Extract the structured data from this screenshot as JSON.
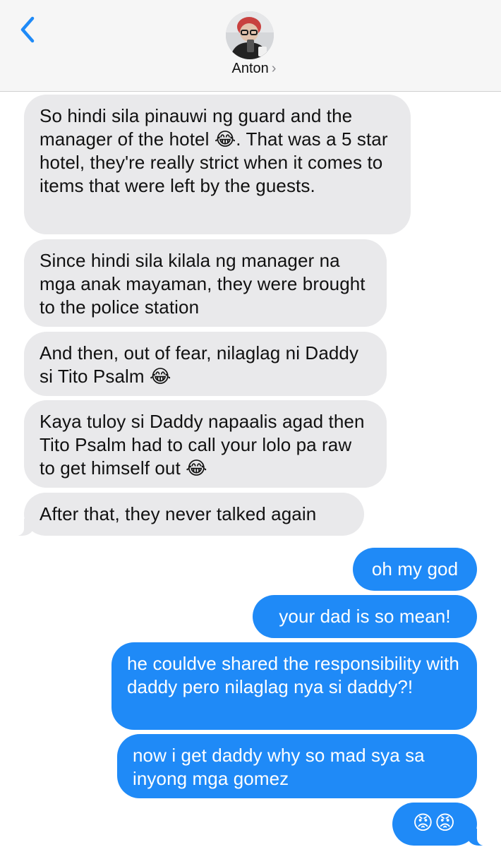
{
  "header": {
    "contact_name": "Anton",
    "chevron": "›",
    "back_icon": "chevron-left-icon",
    "accent": "#1f8af7"
  },
  "messages": [
    {
      "direction": "incoming",
      "text": "So hindi sila pinauwi ng guard and the manager of the hotel 😂. That was a 5 star hotel, they're really strict when it comes to items that were left by the guests."
    },
    {
      "direction": "incoming",
      "text": "Since hindi sila kilala ng manager na mga anak mayaman, they were brought to the police station"
    },
    {
      "direction": "incoming",
      "text": "And then, out of fear, nilaglag ni Daddy si Tito Psalm 😂"
    },
    {
      "direction": "incoming",
      "text": "Kaya tuloy si Daddy napaalis agad then Tito Psalm had to call your lolo pa raw to get himself out 😂"
    },
    {
      "direction": "incoming",
      "text": "After that, they never talked again"
    },
    {
      "direction": "outgoing",
      "text": "oh my god"
    },
    {
      "direction": "outgoing",
      "text": "your dad is so mean!"
    },
    {
      "direction": "outgoing",
      "text": "he couldve shared the responsibility with daddy pero nilaglag nya si daddy?!"
    },
    {
      "direction": "outgoing",
      "text": "now i get daddy why so mad sya sa inyong mga gomez"
    },
    {
      "direction": "outgoing",
      "text": "😡😡"
    }
  ],
  "colors": {
    "incoming_bubble": "#e9e9eb",
    "outgoing_bubble": "#1f8af7",
    "header_bg": "#f6f6f6"
  }
}
